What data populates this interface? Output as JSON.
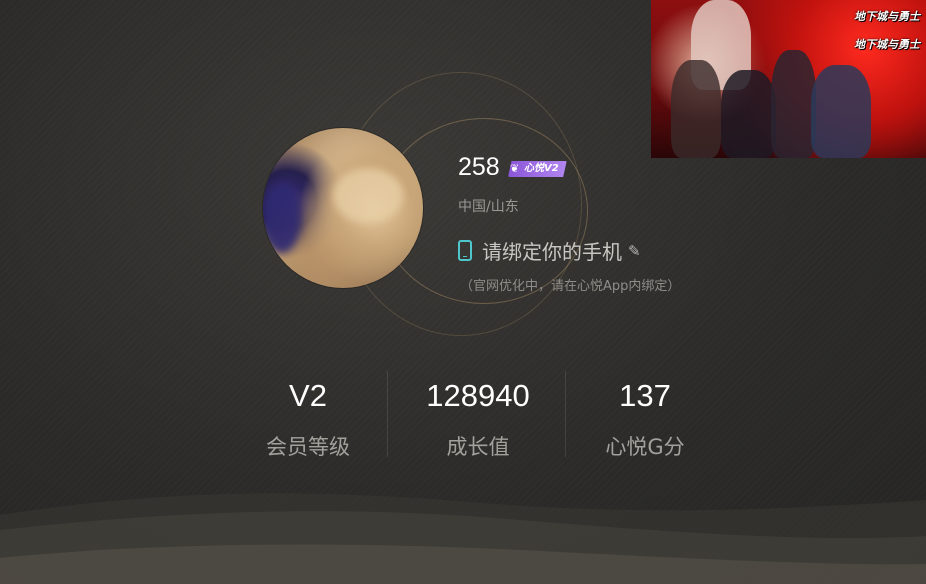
{
  "profile": {
    "uid": "258",
    "vip_badge": "心悦V2",
    "location": "中国/山东",
    "bind_phone_text": "请绑定你的手机",
    "bind_phone_hint": "（官网优化中，请在心悦App内绑定）"
  },
  "stats": [
    {
      "value": "V2",
      "label": "会员等级"
    },
    {
      "value": "128940",
      "label": "成长值"
    },
    {
      "value": "137",
      "label": "心悦G分"
    }
  ],
  "banner": {
    "logo_1": "地下城与勇士",
    "logo_2": "地下城与勇士"
  },
  "icons": {
    "phone": "phone-icon",
    "edit": "edit-icon",
    "vip": "wing-icon"
  },
  "colors": {
    "accent": "#4ec6cc",
    "vip_purple": "#9b6be3",
    "banner_red": "#c0120e"
  }
}
